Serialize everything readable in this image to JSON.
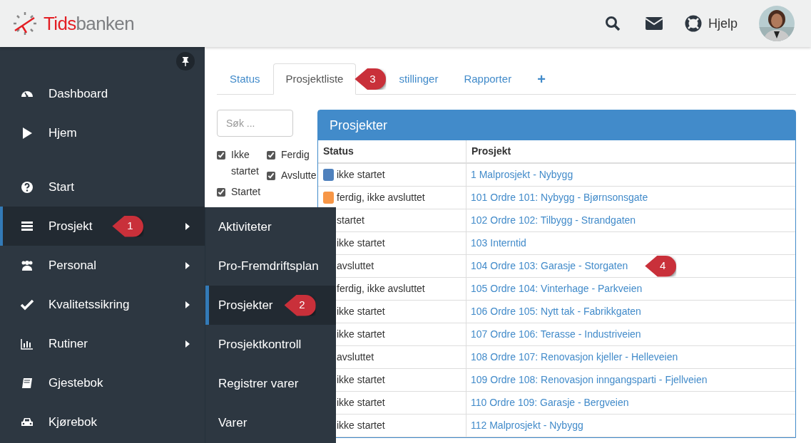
{
  "brand": [
    "Tids",
    "banken"
  ],
  "header": {
    "help": "Hjelp"
  },
  "sidebar": {
    "items": [
      {
        "label": "Dashboard",
        "submenu": false,
        "selected": false
      },
      {
        "label": "Hjem",
        "submenu": false,
        "selected": false
      },
      {
        "label": "Start",
        "submenu": false,
        "selected": false
      },
      {
        "label": "Prosjekt",
        "submenu": true,
        "selected": true,
        "badge": "1"
      },
      {
        "label": "Personal",
        "submenu": true,
        "selected": false
      },
      {
        "label": "Kvalitetssikring",
        "submenu": true,
        "selected": false
      },
      {
        "label": "Rutiner",
        "submenu": true,
        "selected": false
      },
      {
        "label": "Gjestebok",
        "submenu": false,
        "selected": false
      },
      {
        "label": "Kjørebok",
        "submenu": false,
        "selected": false
      }
    ]
  },
  "submenu": {
    "items": [
      {
        "label": "Aktiviteter",
        "selected": false
      },
      {
        "label": "Pro-Fremdriftsplan",
        "selected": false
      },
      {
        "label": "Prosjekter",
        "selected": true,
        "badge": "2"
      },
      {
        "label": "Prosjektkontroll",
        "selected": false
      },
      {
        "label": "Registrer varer",
        "selected": false
      },
      {
        "label": "Varer",
        "selected": false
      }
    ]
  },
  "tabs": [
    {
      "label": "Status",
      "kind": "text",
      "selected": false
    },
    {
      "label": "Prosjektliste",
      "kind": "text",
      "selected": true,
      "badge": "3"
    },
    {
      "label": "stillinger",
      "kind": "text",
      "selected": false
    },
    {
      "label": "Rapporter",
      "kind": "text",
      "selected": false
    },
    {
      "label": "+",
      "kind": "add",
      "selected": false
    }
  ],
  "search": {
    "placeholder": "Søk ..."
  },
  "filters": [
    [
      {
        "label": "Ikke startet",
        "checked": true
      },
      {
        "label": "Startet",
        "checked": true
      }
    ],
    [
      {
        "label": "Ferdig",
        "checked": true
      },
      {
        "label": "Avslutte",
        "checked": true
      }
    ]
  ],
  "table": {
    "title": "Prosjekter",
    "columns": [
      "Status",
      "Prosjekt"
    ],
    "rows": [
      {
        "status": "ikke startet",
        "color": "#4f81bd",
        "project": "1 Malprosjekt - Nybygg"
      },
      {
        "status": "ferdig, ikke avsluttet",
        "color": "#f79646",
        "project": "101 Ordre 101: Nybygg - Bjørnsonsgate"
      },
      {
        "status": "startet",
        "project": "102 Ordre 102: Tilbygg - Strandgaten"
      },
      {
        "status": "ikke startet",
        "project": "103 Interntid"
      },
      {
        "status": "avsluttet",
        "project": "104 Ordre 103: Garasje - Storgaten",
        "badge": "4"
      },
      {
        "status": "ferdig, ikke avsluttet",
        "project": "105 Ordre 104: Vinterhage - Parkveien"
      },
      {
        "status": "ikke startet",
        "project": "106 Ordre 105: Nytt tak - Fabrikkgaten"
      },
      {
        "status": "ikke startet",
        "project": "107 Ordre 106: Terasse - Industriveien"
      },
      {
        "status": "avsluttet",
        "project": "108 Ordre 107: Renovasjon kjeller - Helleveien"
      },
      {
        "status": "ikke startet",
        "project": "109 Ordre 108: Renovasjon inngangsparti - Fjellveien"
      },
      {
        "status": "ikke startet",
        "project": "110 Ordre 109: Garasje - Bergveien"
      },
      {
        "status": "ikke startet",
        "project": "112 Malprosjekt - Nybygg"
      }
    ]
  }
}
